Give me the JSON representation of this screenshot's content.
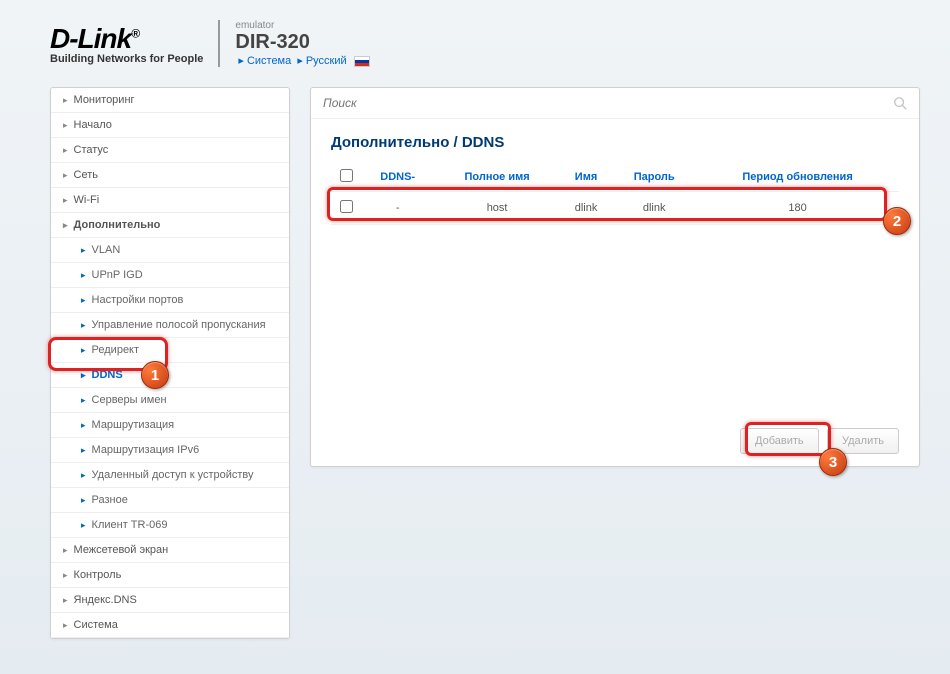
{
  "header": {
    "brand": "D-Link",
    "tagline": "Building Networks for People",
    "emulator": "emulator",
    "model": "DIR-320",
    "crumb1": "Система",
    "crumb2": "Русский"
  },
  "search": {
    "placeholder": "Поиск"
  },
  "breadcrumb": "Дополнительно /  DDNS",
  "sidebar": {
    "items": [
      {
        "label": "Мониторинг"
      },
      {
        "label": "Начало"
      },
      {
        "label": "Статус"
      },
      {
        "label": "Сеть"
      },
      {
        "label": "Wi-Fi"
      },
      {
        "label": "Дополнительно",
        "expanded": true
      },
      {
        "label": "Межсетевой экран"
      },
      {
        "label": "Контроль"
      },
      {
        "label": "Яндекс.DNS"
      },
      {
        "label": "Система"
      }
    ],
    "sub": [
      {
        "label": "VLAN"
      },
      {
        "label": "UPnP IGD"
      },
      {
        "label": "Настройки портов"
      },
      {
        "label": "Управление полосой пропускания"
      },
      {
        "label": "Редирект"
      },
      {
        "label": "DDNS"
      },
      {
        "label": "Серверы имен"
      },
      {
        "label": "Маршрутизация"
      },
      {
        "label": "Маршрутизация IPv6"
      },
      {
        "label": "Удаленный доступ к устройству"
      },
      {
        "label": "Разное"
      },
      {
        "label": "Клиент TR-069"
      }
    ]
  },
  "table": {
    "headers": {
      "c1": "DDNS-",
      "c2": "Полное имя",
      "c3": "Имя",
      "c4": "Пароль",
      "c5": "Период обновления"
    },
    "row": {
      "c1": "-",
      "c2": "host",
      "c3": "dlink",
      "c4": "dlink",
      "c5": "180"
    }
  },
  "buttons": {
    "add": "Добавить",
    "delete": "Удалить"
  },
  "annotations": {
    "one": "1",
    "two": "2",
    "three": "3"
  }
}
